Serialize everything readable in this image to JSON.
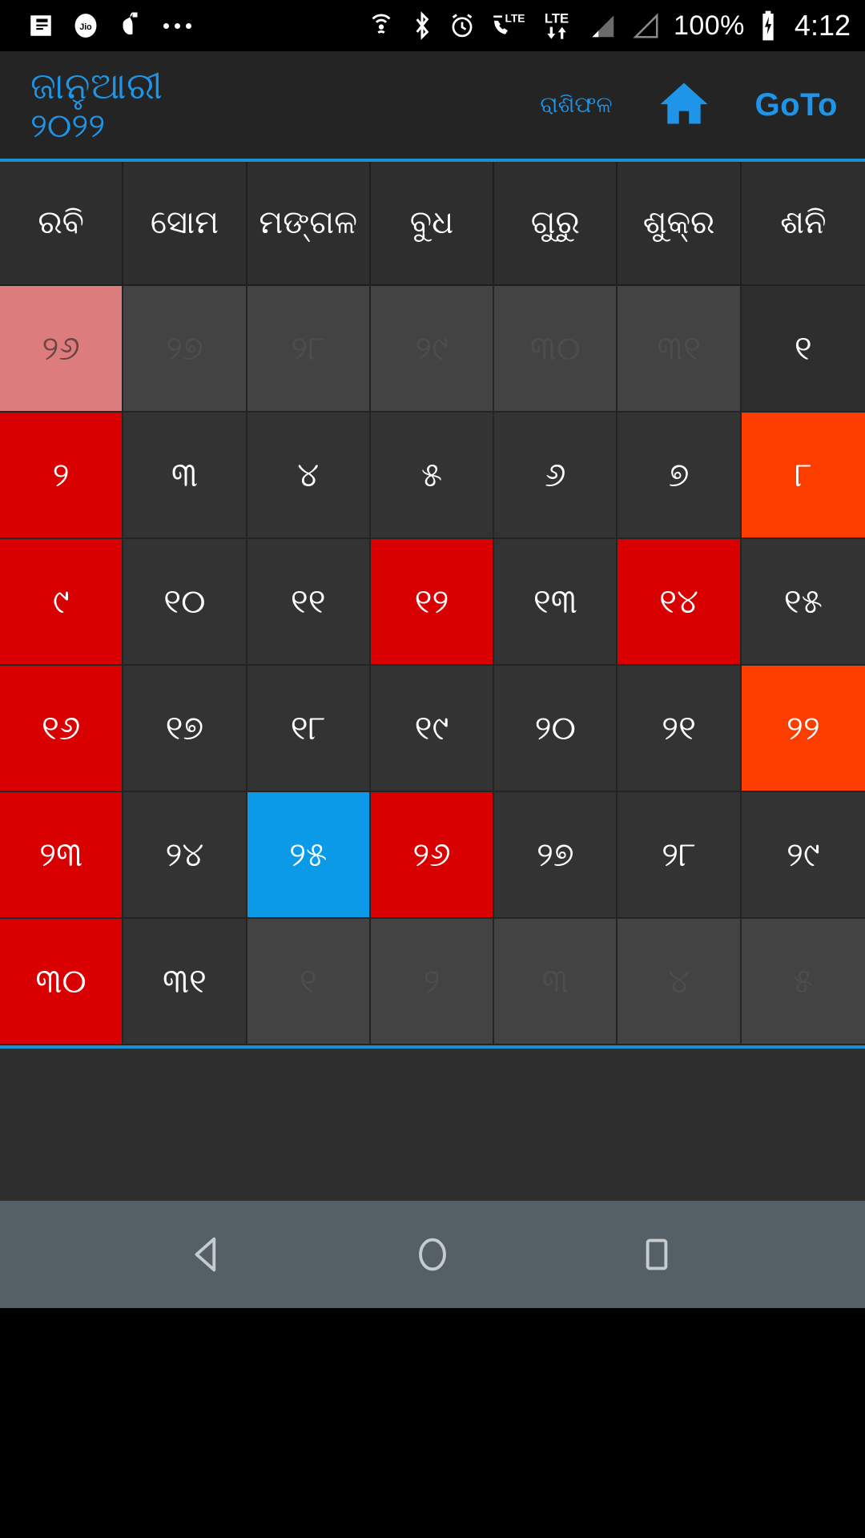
{
  "status_bar": {
    "icons_left": [
      "news-reader-icon",
      "jio-icon",
      "jio-music-icon",
      "more-notifications-icon"
    ],
    "icons_right": [
      "hotspot-icon",
      "bluetooth-icon",
      "alarm-icon",
      "call-lte-icon",
      "lte-data-icon",
      "signal-sim1-icon",
      "signal-sim2-icon"
    ],
    "battery_percent": "100%",
    "battery_icon": "battery-charging-icon",
    "time": "4:12"
  },
  "app_bar": {
    "month": "ଜାନୁଆରୀ",
    "year": "୨୦୨୨",
    "horoscope_label": "ରାଶିଫଳ",
    "home_icon": "home-icon",
    "goto_label": "GoTo"
  },
  "colors": {
    "accent": "#1e95e8",
    "today": "#0a9ae8",
    "holiday": "#d80000",
    "special": "#fc3d00",
    "out_sunday": "#dd7c7c",
    "cell_bg": "#333333",
    "out_bg": "#434343",
    "header_bg": "#242424",
    "divider": "#1a8fd6"
  },
  "weekdays": [
    "ରବି",
    "ସୋମ",
    "ମଙ୍ଗଳ",
    "ବୁଧ",
    "ଗୁରୁ",
    "ଶୁକ୍ର",
    "ଶନି"
  ],
  "weeks": [
    [
      {
        "label": "୨୬",
        "state": "out sun"
      },
      {
        "label": "୨୭",
        "state": "out"
      },
      {
        "label": "୨୮",
        "state": "out"
      },
      {
        "label": "୨୯",
        "state": "out"
      },
      {
        "label": "୩୦",
        "state": "out"
      },
      {
        "label": "୩୧",
        "state": "out"
      },
      {
        "label": "୧",
        "state": "plain-dark"
      }
    ],
    [
      {
        "label": "୨",
        "state": "sun"
      },
      {
        "label": "୩",
        "state": ""
      },
      {
        "label": "୪",
        "state": ""
      },
      {
        "label": "୫",
        "state": ""
      },
      {
        "label": "୬",
        "state": ""
      },
      {
        "label": "୭",
        "state": ""
      },
      {
        "label": "୮",
        "state": "special"
      }
    ],
    [
      {
        "label": "୯",
        "state": "sun"
      },
      {
        "label": "୧୦",
        "state": ""
      },
      {
        "label": "୧୧",
        "state": ""
      },
      {
        "label": "୧୨",
        "state": "festival"
      },
      {
        "label": "୧୩",
        "state": ""
      },
      {
        "label": "୧୪",
        "state": "festival"
      },
      {
        "label": "୧୫",
        "state": ""
      }
    ],
    [
      {
        "label": "୧୬",
        "state": "sun"
      },
      {
        "label": "୧୭",
        "state": ""
      },
      {
        "label": "୧୮",
        "state": ""
      },
      {
        "label": "୧୯",
        "state": ""
      },
      {
        "label": "୨୦",
        "state": ""
      },
      {
        "label": "୨୧",
        "state": ""
      },
      {
        "label": "୨୨",
        "state": "special"
      }
    ],
    [
      {
        "label": "୨୩",
        "state": "sun"
      },
      {
        "label": "୨୪",
        "state": ""
      },
      {
        "label": "୨୫",
        "state": "today"
      },
      {
        "label": "୨୬",
        "state": "festival"
      },
      {
        "label": "୨୭",
        "state": ""
      },
      {
        "label": "୨୮",
        "state": ""
      },
      {
        "label": "୨୯",
        "state": ""
      }
    ],
    [
      {
        "label": "୩୦",
        "state": "sun"
      },
      {
        "label": "୩୧",
        "state": ""
      },
      {
        "label": "୧",
        "state": "out"
      },
      {
        "label": "୨",
        "state": "out"
      },
      {
        "label": "୩",
        "state": "out"
      },
      {
        "label": "୪",
        "state": "out"
      },
      {
        "label": "୫",
        "state": "out"
      }
    ]
  ],
  "nav_bar": {
    "back": "back-triangle-icon",
    "home": "home-circle-icon",
    "recents": "recents-square-icon"
  }
}
